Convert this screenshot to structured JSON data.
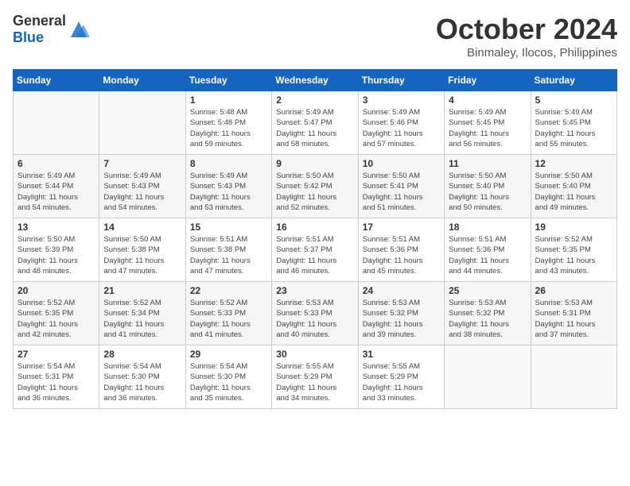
{
  "header": {
    "logo_general": "General",
    "logo_blue": "Blue",
    "month": "October 2024",
    "location": "Binmaley, Ilocos, Philippines"
  },
  "days_of_week": [
    "Sunday",
    "Monday",
    "Tuesday",
    "Wednesday",
    "Thursday",
    "Friday",
    "Saturday"
  ],
  "weeks": [
    [
      {
        "day": "",
        "content": ""
      },
      {
        "day": "",
        "content": ""
      },
      {
        "day": "1",
        "content": "Sunrise: 5:48 AM\nSunset: 5:48 PM\nDaylight: 11 hours\nand 59 minutes."
      },
      {
        "day": "2",
        "content": "Sunrise: 5:49 AM\nSunset: 5:47 PM\nDaylight: 11 hours\nand 58 minutes."
      },
      {
        "day": "3",
        "content": "Sunrise: 5:49 AM\nSunset: 5:46 PM\nDaylight: 11 hours\nand 57 minutes."
      },
      {
        "day": "4",
        "content": "Sunrise: 5:49 AM\nSunset: 5:45 PM\nDaylight: 11 hours\nand 56 minutes."
      },
      {
        "day": "5",
        "content": "Sunrise: 5:49 AM\nSunset: 5:45 PM\nDaylight: 11 hours\nand 55 minutes."
      }
    ],
    [
      {
        "day": "6",
        "content": "Sunrise: 5:49 AM\nSunset: 5:44 PM\nDaylight: 11 hours\nand 54 minutes."
      },
      {
        "day": "7",
        "content": "Sunrise: 5:49 AM\nSunset: 5:43 PM\nDaylight: 11 hours\nand 54 minutes."
      },
      {
        "day": "8",
        "content": "Sunrise: 5:49 AM\nSunset: 5:43 PM\nDaylight: 11 hours\nand 53 minutes."
      },
      {
        "day": "9",
        "content": "Sunrise: 5:50 AM\nSunset: 5:42 PM\nDaylight: 11 hours\nand 52 minutes."
      },
      {
        "day": "10",
        "content": "Sunrise: 5:50 AM\nSunset: 5:41 PM\nDaylight: 11 hours\nand 51 minutes."
      },
      {
        "day": "11",
        "content": "Sunrise: 5:50 AM\nSunset: 5:40 PM\nDaylight: 11 hours\nand 50 minutes."
      },
      {
        "day": "12",
        "content": "Sunrise: 5:50 AM\nSunset: 5:40 PM\nDaylight: 11 hours\nand 49 minutes."
      }
    ],
    [
      {
        "day": "13",
        "content": "Sunrise: 5:50 AM\nSunset: 5:39 PM\nDaylight: 11 hours\nand 48 minutes."
      },
      {
        "day": "14",
        "content": "Sunrise: 5:50 AM\nSunset: 5:38 PM\nDaylight: 11 hours\nand 47 minutes."
      },
      {
        "day": "15",
        "content": "Sunrise: 5:51 AM\nSunset: 5:38 PM\nDaylight: 11 hours\nand 47 minutes."
      },
      {
        "day": "16",
        "content": "Sunrise: 5:51 AM\nSunset: 5:37 PM\nDaylight: 11 hours\nand 46 minutes."
      },
      {
        "day": "17",
        "content": "Sunrise: 5:51 AM\nSunset: 5:36 PM\nDaylight: 11 hours\nand 45 minutes."
      },
      {
        "day": "18",
        "content": "Sunrise: 5:51 AM\nSunset: 5:36 PM\nDaylight: 11 hours\nand 44 minutes."
      },
      {
        "day": "19",
        "content": "Sunrise: 5:52 AM\nSunset: 5:35 PM\nDaylight: 11 hours\nand 43 minutes."
      }
    ],
    [
      {
        "day": "20",
        "content": "Sunrise: 5:52 AM\nSunset: 5:35 PM\nDaylight: 11 hours\nand 42 minutes."
      },
      {
        "day": "21",
        "content": "Sunrise: 5:52 AM\nSunset: 5:34 PM\nDaylight: 11 hours\nand 41 minutes."
      },
      {
        "day": "22",
        "content": "Sunrise: 5:52 AM\nSunset: 5:33 PM\nDaylight: 11 hours\nand 41 minutes."
      },
      {
        "day": "23",
        "content": "Sunrise: 5:53 AM\nSunset: 5:33 PM\nDaylight: 11 hours\nand 40 minutes."
      },
      {
        "day": "24",
        "content": "Sunrise: 5:53 AM\nSunset: 5:32 PM\nDaylight: 11 hours\nand 39 minutes."
      },
      {
        "day": "25",
        "content": "Sunrise: 5:53 AM\nSunset: 5:32 PM\nDaylight: 11 hours\nand 38 minutes."
      },
      {
        "day": "26",
        "content": "Sunrise: 5:53 AM\nSunset: 5:31 PM\nDaylight: 11 hours\nand 37 minutes."
      }
    ],
    [
      {
        "day": "27",
        "content": "Sunrise: 5:54 AM\nSunset: 5:31 PM\nDaylight: 11 hours\nand 36 minutes."
      },
      {
        "day": "28",
        "content": "Sunrise: 5:54 AM\nSunset: 5:30 PM\nDaylight: 11 hours\nand 36 minutes."
      },
      {
        "day": "29",
        "content": "Sunrise: 5:54 AM\nSunset: 5:30 PM\nDaylight: 11 hours\nand 35 minutes."
      },
      {
        "day": "30",
        "content": "Sunrise: 5:55 AM\nSunset: 5:29 PM\nDaylight: 11 hours\nand 34 minutes."
      },
      {
        "day": "31",
        "content": "Sunrise: 5:55 AM\nSunset: 5:29 PM\nDaylight: 11 hours\nand 33 minutes."
      },
      {
        "day": "",
        "content": ""
      },
      {
        "day": "",
        "content": ""
      }
    ]
  ]
}
